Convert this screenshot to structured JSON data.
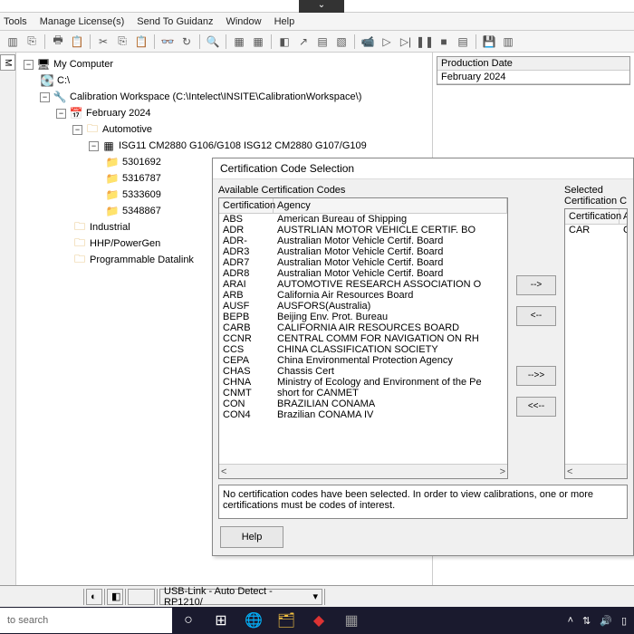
{
  "menu": {
    "tools": "Tools",
    "lic": "Manage License(s)",
    "send": "Send To Guidanz",
    "win": "Window",
    "help": "Help"
  },
  "tree": {
    "root": "My Computer",
    "c": "C:\\",
    "ws": "Calibration Workspace  (C:\\Intelect\\INSITE\\CalibrationWorkspace\\)",
    "month": "February 2024",
    "auto": "Automotive",
    "ecm": "ISG11 CM2880 G106/G108 ISG12 CM2880 G107/G109",
    "c1": "5301692",
    "c2": "5316787",
    "c3": "5333609",
    "c4": "5348867",
    "ind": "Industrial",
    "hhp": "HHP/PowerGen",
    "pdl": "Programmable Datalink"
  },
  "right": {
    "prodhead": "Production Date",
    "prodval": "February 2024"
  },
  "dialog": {
    "title": "Certification Code Selection",
    "avail": "Available Certification Codes",
    "sel": "Selected Certification C",
    "colCert": "Certification",
    "colAgency": "Agency",
    "rows": [
      [
        "ABS",
        "American Bureau of Shipping"
      ],
      [
        "ADR",
        "AUSTRLIAN MOTOR VEHICLE CERTIF. BO"
      ],
      [
        "ADR-",
        "Australian Motor Vehicle Certif. Board"
      ],
      [
        "ADR3",
        "Australian Motor Vehicle Certif. Board"
      ],
      [
        "ADR7",
        "Australian Motor Vehicle Certif. Board"
      ],
      [
        "ADR8",
        "Australian Motor Vehicle Certif. Board"
      ],
      [
        "ARAI",
        "AUTOMOTIVE RESEARCH ASSOCIATION O"
      ],
      [
        "ARB",
        "California Air Resources Board"
      ],
      [
        "AUSF",
        "AUSFORS(Australia)"
      ],
      [
        "BEPB",
        "Beijing Env. Prot. Bureau"
      ],
      [
        "CARB",
        "CALIFORNIA AIR RESOURCES BOARD"
      ],
      [
        "CCNR",
        "CENTRAL COMM FOR NAVIGATION ON RH"
      ],
      [
        "CCS",
        "CHINA CLASSIFICATION SOCIETY"
      ],
      [
        "CEPA",
        "China Environmental Protection Agency"
      ],
      [
        "CHAS",
        "Chassis Cert"
      ],
      [
        "CHNA",
        "Ministry of Ecology and Environment of the Pe"
      ],
      [
        "CNMT",
        "short for CANMET"
      ],
      [
        "CON",
        "BRAZILIAN CONAMA"
      ],
      [
        "CON4",
        "Brazilian CONAMA IV"
      ]
    ],
    "selrow": [
      "CAR",
      "Californ"
    ],
    "mv1": "-->",
    "mv2": "<--",
    "mv3": "-->>",
    "mv4": "<<--",
    "msg": "No certification codes have been selected.  In order to view calibrations, one or more certifications must be codes of interest.",
    "help": "Help"
  },
  "status": {
    "link": "USB-Link - Auto Detect - RP1210/"
  },
  "taskbar": {
    "search": "to search"
  }
}
